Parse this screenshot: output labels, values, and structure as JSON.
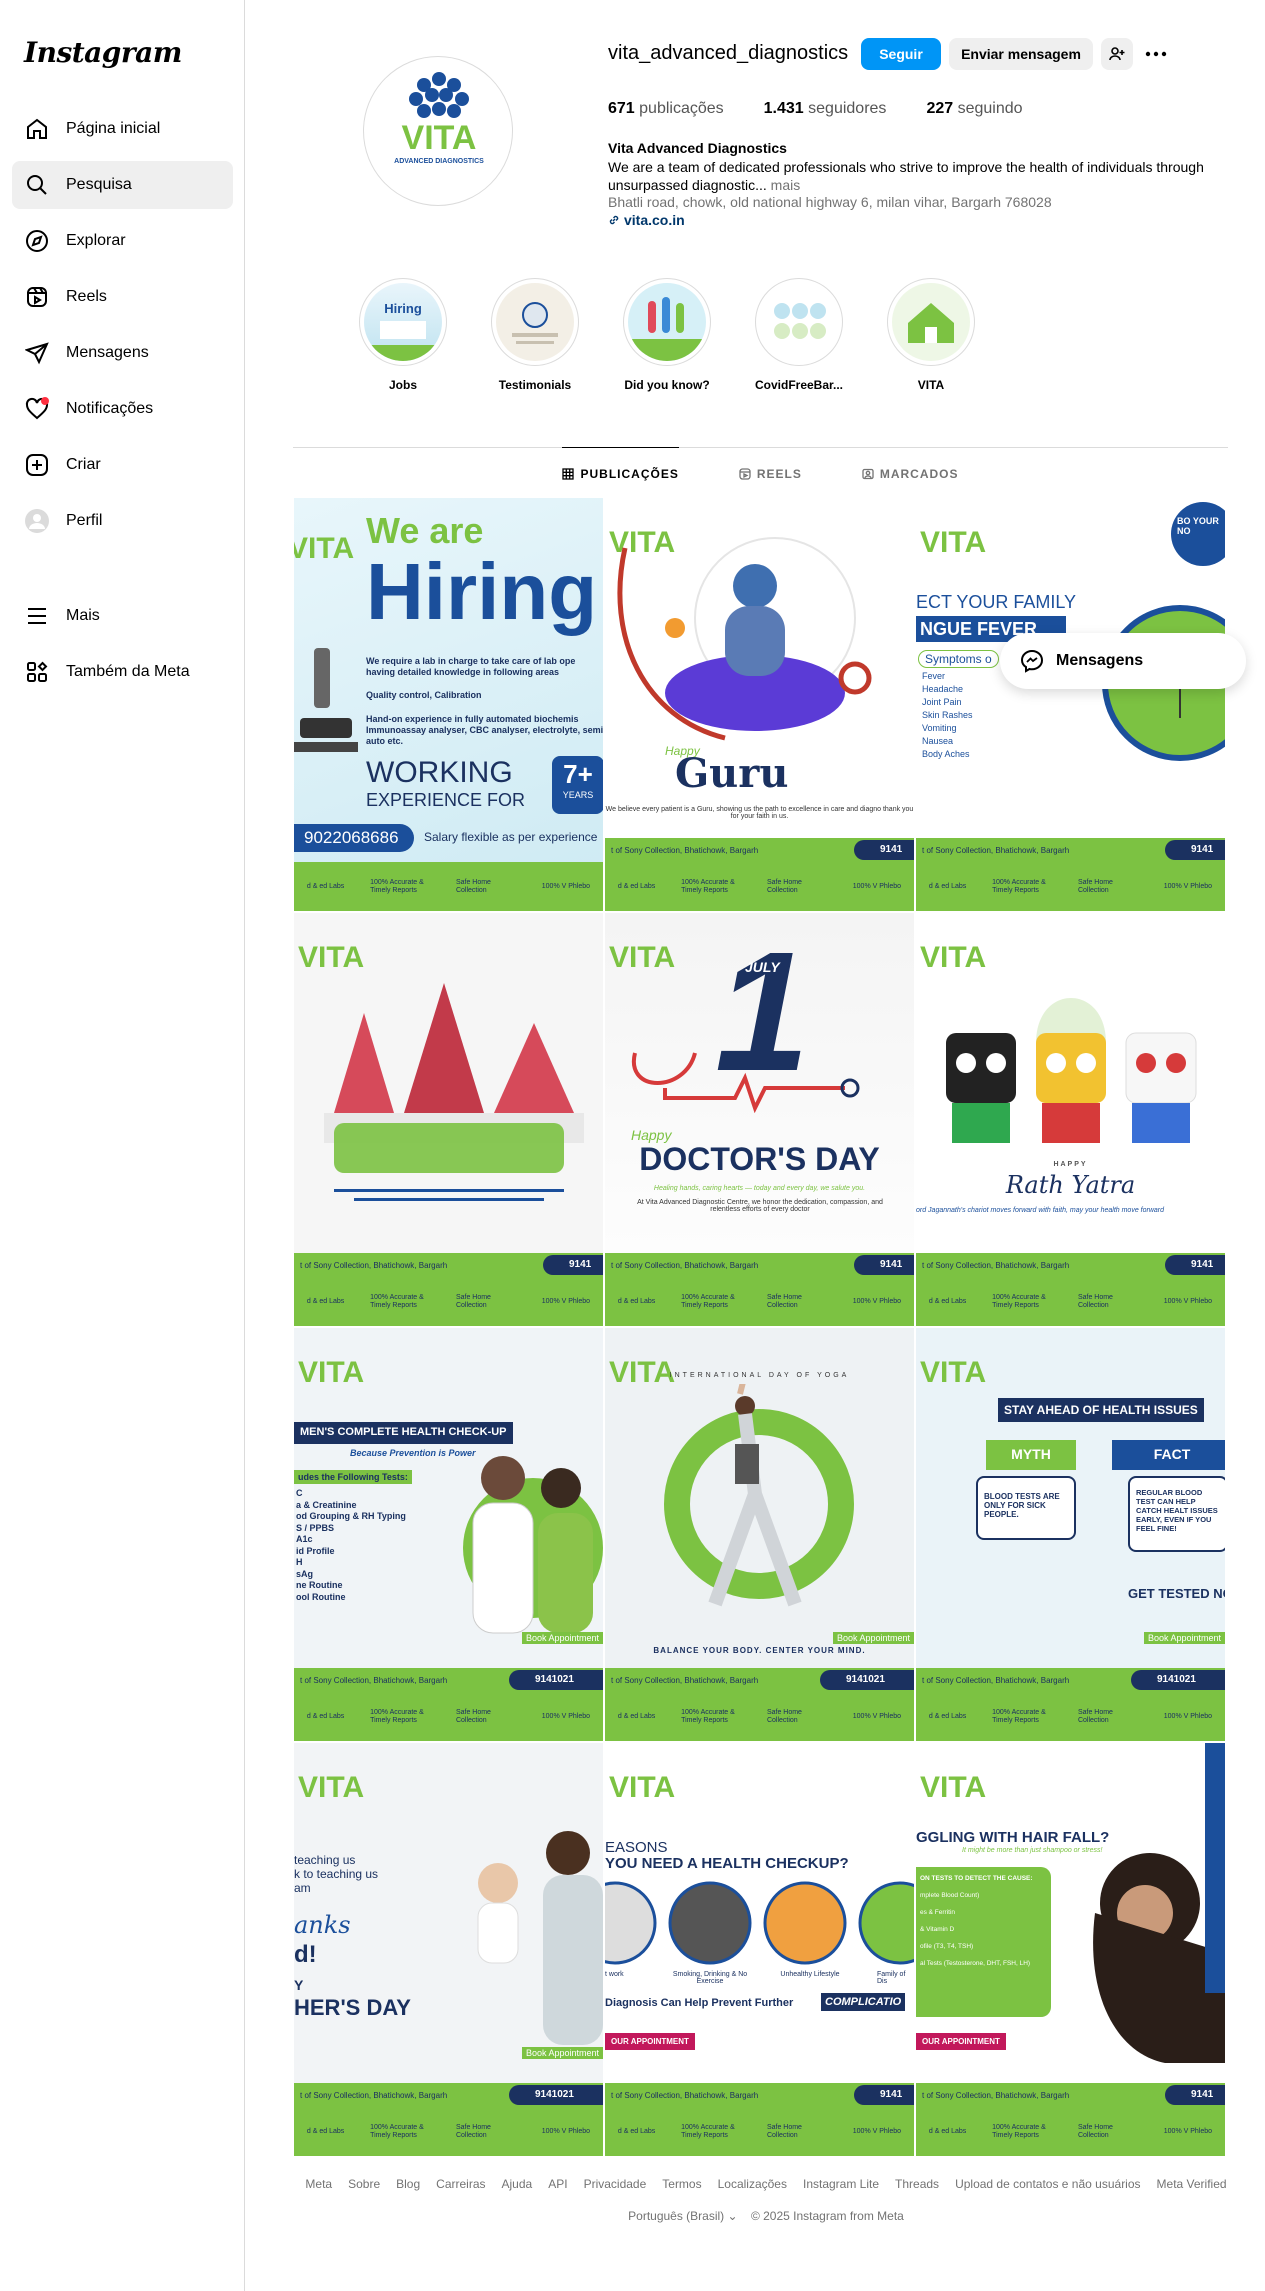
{
  "app": {
    "name": "Instagram"
  },
  "sidebar": {
    "items": [
      {
        "label": "Página inicial",
        "icon": "home-icon"
      },
      {
        "label": "Pesquisa",
        "icon": "search-icon"
      },
      {
        "label": "Explorar",
        "icon": "compass-icon"
      },
      {
        "label": "Reels",
        "icon": "reels-icon"
      },
      {
        "label": "Mensagens",
        "icon": "send-icon"
      },
      {
        "label": "Notificações",
        "icon": "heart-icon"
      },
      {
        "label": "Criar",
        "icon": "plus-square-icon"
      },
      {
        "label": "Perfil",
        "icon": "avatar-icon"
      }
    ],
    "bottom": [
      {
        "label": "Mais",
        "icon": "menu-icon"
      },
      {
        "label": "Também da Meta",
        "icon": "meta-apps-icon"
      }
    ]
  },
  "profile": {
    "username": "vita_advanced_diagnostics",
    "follow_label": "Seguir",
    "message_label": "Enviar mensagem",
    "stats": {
      "posts_count": "671",
      "posts_label": "publicações",
      "followers_count": "1.431",
      "followers_label": "seguidores",
      "following_count": "227",
      "following_label": "seguindo"
    },
    "full_name": "Vita Advanced Diagnostics",
    "bio": "We are a team of dedicated professionals who strive to improve the health of individuals through unsurpassed diagnostic...",
    "bio_more": "mais",
    "address": "Bhatli road, chowk, old national highway 6, milan vihar, Bargarh 768028",
    "website": "vita.co.in",
    "logo_text": "VITA",
    "logo_sub": "ADVANCED DIAGNOSTICS"
  },
  "highlights": [
    {
      "label": "Jobs"
    },
    {
      "label": "Testimonials"
    },
    {
      "label": "Did you know?"
    },
    {
      "label": "CovidFreeBar..."
    },
    {
      "label": "VITA"
    }
  ],
  "tabs": [
    {
      "label": "PUBLICAÇÕES",
      "active": true
    },
    {
      "label": "REELS",
      "active": false
    },
    {
      "label": "MARCADOS",
      "active": false
    }
  ],
  "posts": {
    "address_line": "t of Sony Collection, Bhatichowk, Bargarh",
    "phone_short": "9141",
    "phone": "9141021",
    "book_label": "Book Appointment",
    "footer_a": "100% Accurate & Timely Reports",
    "footer_b": "Safe Home Collection",
    "footer_c": "100% V Phlebo",
    "footer_left": "d & ed Labs",
    "p1_title_a": "We are",
    "p1_title_b": "Hiring",
    "p1_text": "We require a lab in charge to take care of lab ope having detailed knowledge in following areas",
    "p1_bullet1": "Quality control, Calibration",
    "p1_bullet2": "Hand-on experience in fully automated biochemis Immunoassay analyser, CBC analyser, electrolyte, semi auto etc.",
    "p1_working": "WORKING",
    "p1_exp": "EXPERIENCE FOR",
    "p1_years": "7+",
    "p1_years_label": "YEARS",
    "p1_phone": "9022068686",
    "p1_salary": "Salary flexible as per experience",
    "p2_guru": "Guru",
    "p2_happy": "Happy",
    "p2_text": "We believe every patient is a Guru, showing us the path to excellence in care and diagno thank you for your faith in us.",
    "p3_title": "ECT YOUR FAMILY",
    "p3_sub": "NGUE FEVER",
    "p3_symptoms": "Symptoms o",
    "p3_list": [
      "Fever",
      "Headache",
      "Joint Pain",
      "Skin Rashes",
      "Vomiting",
      "Nausea",
      "Body Aches"
    ],
    "p3_badge": "BO YOUR NO",
    "p5_month": "JULY",
    "p5_day": "1",
    "p5_happy": "Happy",
    "p5_title": "DOCTOR'S DAY",
    "p5_tag": "Healing hands, caring hearts — today and every day, we salute you.",
    "p5_text": "At Vita Advanced Diagnostic Centre, we honor the dedication, compassion, and relentless efforts of every doctor",
    "p6_happy": "HAPPY",
    "p6_title": "Rath Yatra",
    "p6_text": "ord Jagannath's chariot moves forward with faith, may your health move forward",
    "p7_title": "MEN'S COMPLETE HEALTH CHECK-UP",
    "p7_sub": "Because Prevention is Power",
    "p7_includes": "udes the Following Tests:",
    "p7_list": [
      "C",
      "a & Creatinine",
      "od Grouping & RH Typing",
      "S / PPBS",
      "A1c",
      "id Profile",
      "H",
      "sAg",
      "ne Routine",
      "ool Routine"
    ],
    "p8_title": "INTERNATIONAL DAY OF YOGA",
    "p8_tag": "BALANCE YOUR BODY. CENTER YOUR MIND.",
    "p9_title": "STAY AHEAD OF HEALTH ISSUES",
    "p9_myth": "MYTH",
    "p9_fact": "FACT",
    "p9_myth_text": "BLOOD TESTS ARE ONLY FOR SICK PEOPLE.",
    "p9_fact_text": "REGULAR BLOOD TEST CAN HELP CATCH HEALT ISSUES EARLY, EVEN IF YOU FEEL FINE!",
    "p9_cta": "GET TESTED NO",
    "p10_lines": [
      "teaching us",
      "k to teaching us",
      "am"
    ],
    "p10_thanks": "anks",
    "p10_d": "d!",
    "p10_y": "Y",
    "p10_day": "HER'S DAY",
    "p11_title_a": "EASONS",
    "p11_title_b": "YOU NEED A HEALTH CHECKUP?",
    "p11_items": [
      "t work",
      "Smoking, Drinking & No Exercise",
      "Unhealthy Lifestyle",
      "Family of Dis"
    ],
    "p11_bar": "Diagnosis Can Help Prevent Further",
    "p11_bar_b": "COMPLICATIO",
    "p11_cta": "OUR APPOINTMENT",
    "p12_title": "GGLING WITH HAIR FALL?",
    "p12_sub": "It might be more than just shampoo or stress!",
    "p12_tests": "ON TESTS TO DETECT THE CAUSE:",
    "p12_list": [
      "mplete Blood Count)",
      "es & Ferritin",
      "& Vitamin D",
      "ofile (T3, T4, TSH)",
      "al Tests (Testosterone, DHT, FSH, LH)"
    ],
    "p12_cta": "OUR APPOINTMENT"
  },
  "messages_float": {
    "label": "Mensagens"
  },
  "footer": {
    "links": [
      "Meta",
      "Sobre",
      "Blog",
      "Carreiras",
      "Ajuda",
      "API",
      "Privacidade",
      "Termos",
      "Localizações",
      "Instagram Lite",
      "Threads",
      "Upload de contatos e não usuários",
      "Meta Verified"
    ],
    "language": "Português (Brasil)",
    "copyright": "© 2025 Instagram from Meta"
  },
  "colors": {
    "accent": "#0095f6",
    "brand_green": "#7cc242",
    "brand_blue": "#1b4f9b",
    "navy": "#1b3160"
  }
}
